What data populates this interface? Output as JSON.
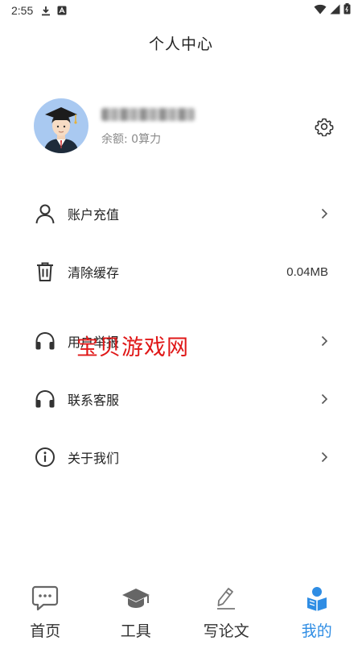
{
  "status_bar": {
    "time": "2:55"
  },
  "header": {
    "title": "个人中心"
  },
  "profile": {
    "balance_text": "余额: 0算力"
  },
  "menu": {
    "recharge_label": "账户充值",
    "clear_cache_label": "清除缓存",
    "cache_size": "0.04MB",
    "feedback_label": "用户举报",
    "support_label": "联系客服",
    "about_label": "关于我们"
  },
  "watermark": "宝贝游戏网",
  "tabs": [
    {
      "label": "首页",
      "icon": "chat-bubble-icon"
    },
    {
      "label": "工具",
      "icon": "graduation-cap-icon"
    },
    {
      "label": "写论文",
      "icon": "pencil-icon"
    },
    {
      "label": "我的",
      "icon": "person-book-icon"
    }
  ],
  "colors": {
    "accent": "#2f8de4",
    "watermark": "#e01818",
    "avatar_bg": "#a9c9f1"
  }
}
